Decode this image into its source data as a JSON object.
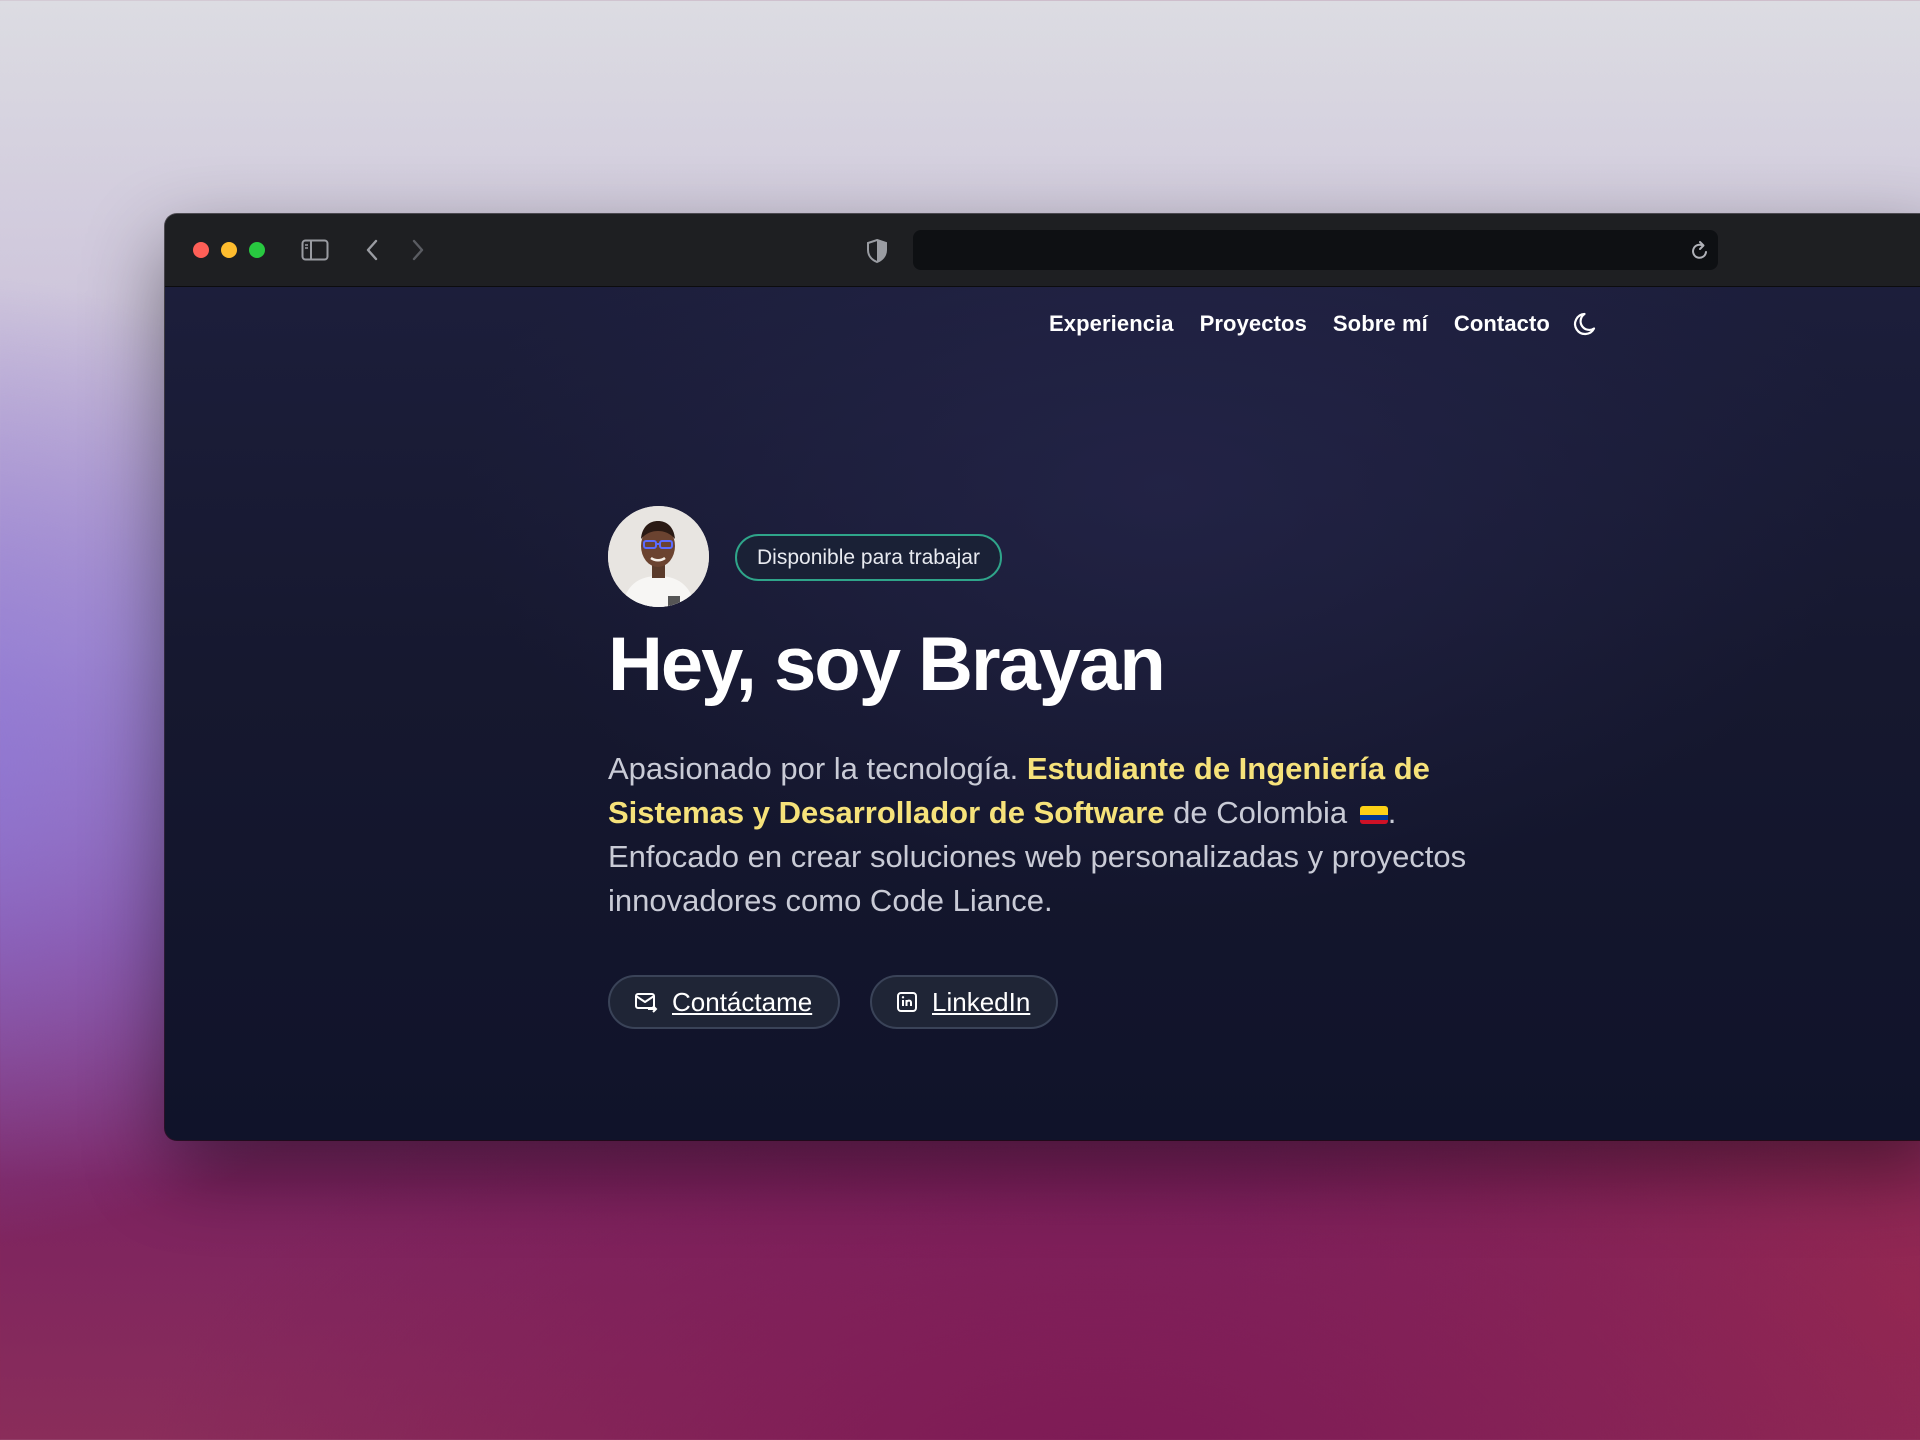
{
  "browser": {
    "url": "",
    "traffic_lights": [
      "close",
      "minimize",
      "zoom"
    ],
    "icons": [
      "sidebar-icon",
      "back-icon",
      "forward-icon",
      "shield-icon",
      "reload-icon"
    ]
  },
  "nav": {
    "items": [
      {
        "label": "Experiencia"
      },
      {
        "label": "Proyectos"
      },
      {
        "label": "Sobre mí"
      },
      {
        "label": "Contacto"
      }
    ],
    "theme_icon": "moon-icon"
  },
  "hero": {
    "badge": "Disponible para trabajar",
    "title": "Hey, soy Brayan",
    "desc_intro": "Apasionado por la tecnología. ",
    "desc_highlight": "Estudiante de Ingeniería de Sistemas y Desarrollador de Software",
    "desc_middle": " de Colombia ",
    "desc_flag": "colombia-flag-icon",
    "desc_end": ". Enfocado en crear soluciones web personalizadas y proyectos innovadores como Code Liance.",
    "buttons": {
      "contact": "Contáctame",
      "linkedin": "LinkedIn"
    }
  },
  "colors": {
    "highlight": "#f6e27a",
    "badge_border": "#2fa58a",
    "page_bg": "#16182f"
  }
}
